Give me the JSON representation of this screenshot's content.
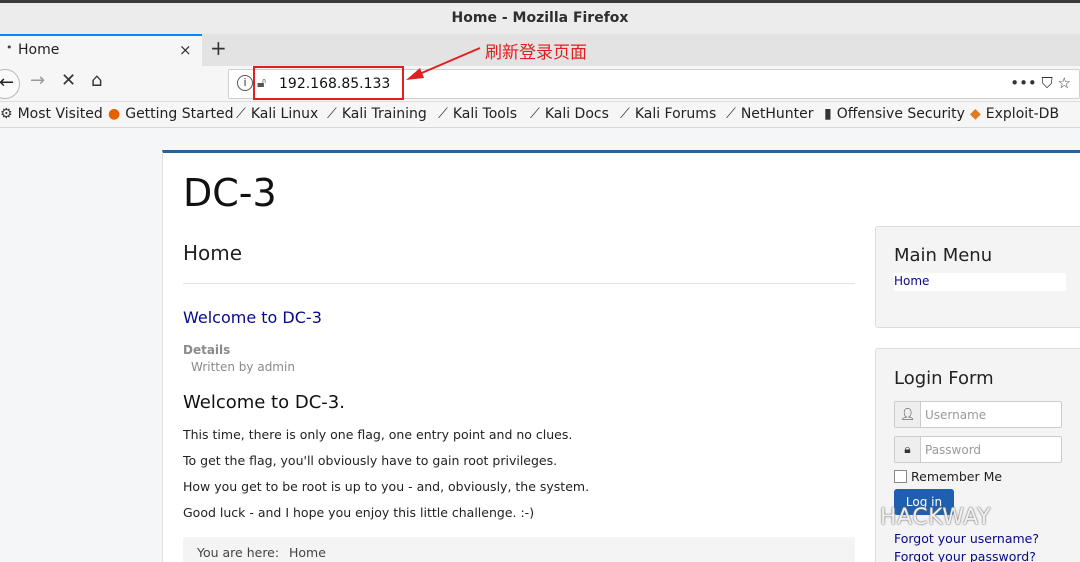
{
  "window": {
    "title": "Home - Mozilla Firefox"
  },
  "tab": {
    "label": "Home",
    "close": "×",
    "new_tab": "+"
  },
  "nav": {
    "back": "←",
    "forward": "→",
    "stop": "✕",
    "home": "⌂",
    "url": "192.168.85.133",
    "page_actions": "•••  ⛉  ☆"
  },
  "annotation": {
    "text": "刷新登录页面",
    "color": "#e02020"
  },
  "bookmarks": [
    {
      "label": "Most Visited",
      "icon": "gear-icon"
    },
    {
      "label": "Getting Started",
      "icon": "firefox-icon"
    },
    {
      "label": "Kali Linux",
      "icon": "kali-dragon-icon"
    },
    {
      "label": "Kali Training",
      "icon": "kali-dragon-icon"
    },
    {
      "label": "Kali Tools",
      "icon": "kali-dragon-icon"
    },
    {
      "label": "Kali Docs",
      "icon": "kali-dragon-icon"
    },
    {
      "label": "Kali Forums",
      "icon": "kali-dragon-icon"
    },
    {
      "label": "NetHunter",
      "icon": "kali-dragon-icon"
    },
    {
      "label": "Offensive Security",
      "icon": "offsec-icon"
    },
    {
      "label": "Exploit-DB",
      "icon": "exploitdb-icon"
    }
  ],
  "site": {
    "title": "DC-3",
    "page_heading": "Home",
    "article": {
      "title": "Welcome to DC-3",
      "details_label": "Details",
      "written_by": "Written by admin",
      "heading": "Welcome to DC-3.",
      "paragraphs": [
        "This time, there is only one flag, one entry point and no clues.",
        "To get the flag, you'll obviously have to gain root privileges.",
        "How you get to be root is up to you - and, obviously, the system.",
        "Good luck - and I hope you enjoy this little challenge.  :-)"
      ]
    },
    "breadcrumb": {
      "label": "You are here:",
      "current": "Home"
    }
  },
  "sidebar": {
    "main_menu": {
      "title": "Main Menu",
      "items": [
        "Home"
      ]
    },
    "login_form": {
      "title": "Login Form",
      "username_placeholder": "Username",
      "password_placeholder": "Password",
      "remember_me": "Remember Me",
      "login_button": "Log in",
      "forgot_username": "Forgot your username?",
      "forgot_password": "Forgot your password?"
    }
  },
  "watermark": "HACKWAY",
  "colors": {
    "accent": "#0a84ff",
    "link": "#08088a",
    "button": "#1e5fb0"
  }
}
